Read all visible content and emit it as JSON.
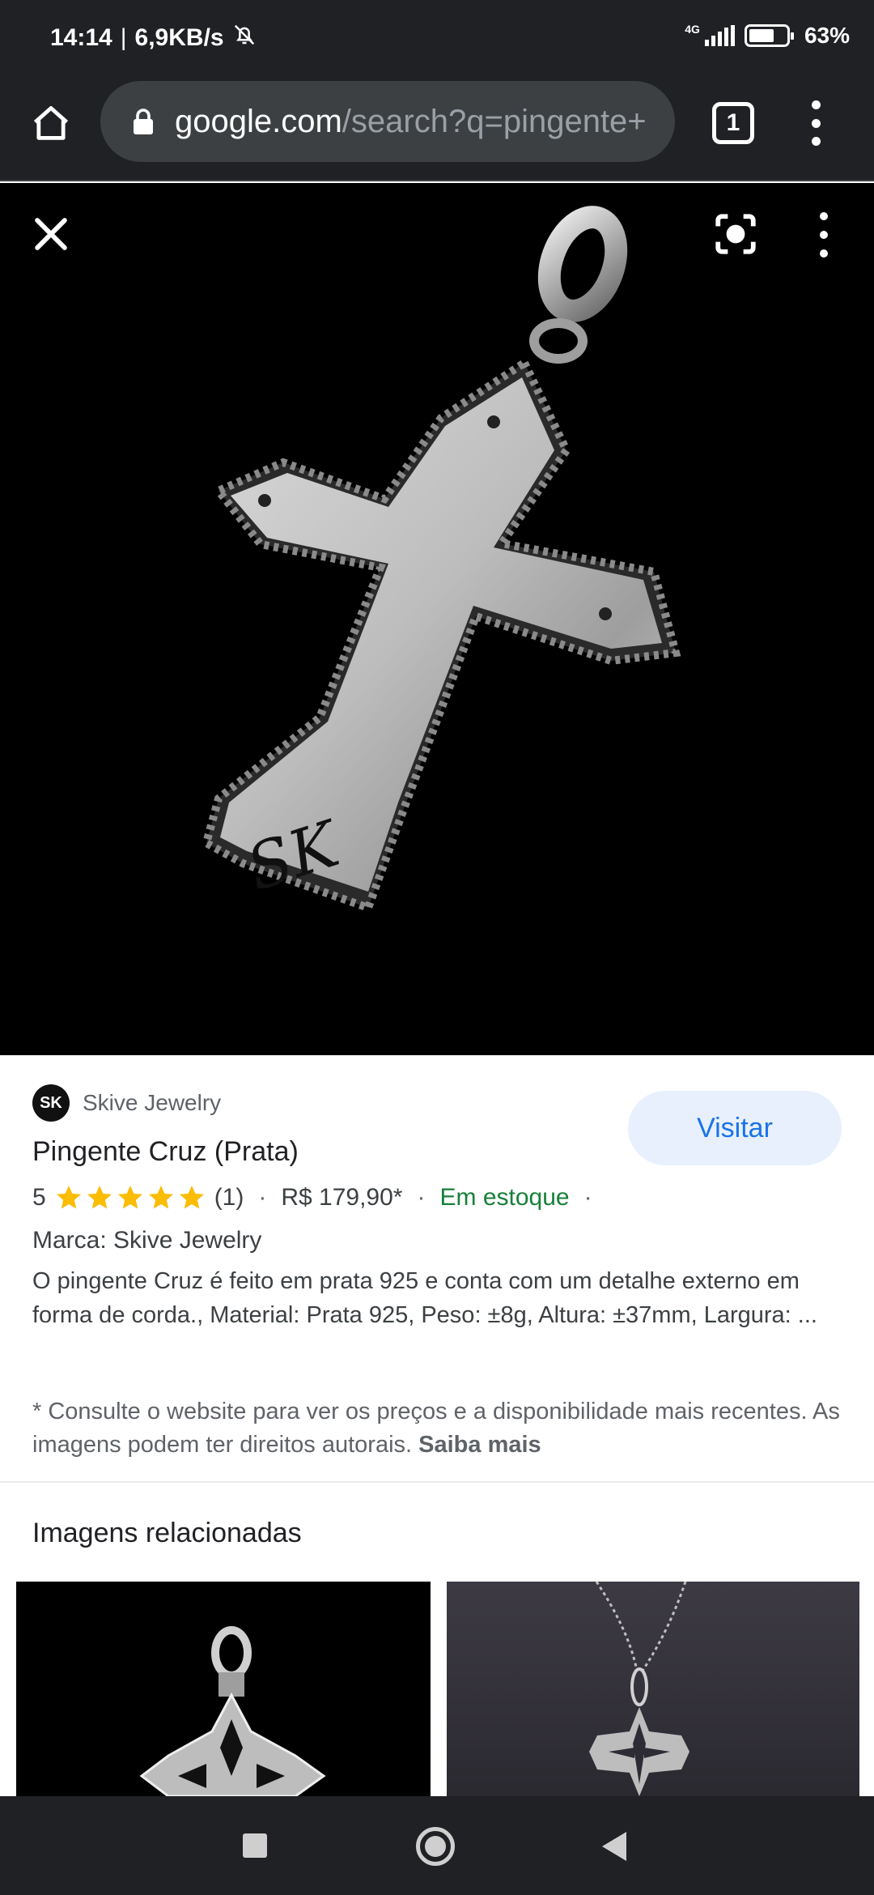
{
  "status_bar": {
    "time": "14:14",
    "separator": "|",
    "speed": "6,9KB/s",
    "network": "4G",
    "battery": "63%"
  },
  "browser": {
    "url_host": "google.com",
    "url_path": "/search?q=pingente+",
    "tab_count": "1"
  },
  "product": {
    "source": "Skive Jewelry",
    "source_logo_text": "SK",
    "visit_label": "Visitar",
    "title": "Pingente Cruz (Prata)",
    "rating": "5",
    "rating_value": 5,
    "reviews": "(1)",
    "price": "R$ 179,90*",
    "availability": "Em estoque",
    "brand": "Marca: Skive Jewelry",
    "description": "O pingente Cruz é feito em prata 925 e conta com um detalhe externo em forma de corda., Material: Prata 925, Peso: ±8g, Altura: ±37mm, Largura: ...",
    "disclaimer": "* Consulte o website para ver os preços e a disponibilidade mais recentes. As imagens podem ter direitos autorais.",
    "learn_more": "Saiba mais",
    "engraving": "SK"
  },
  "related": {
    "title": "Imagens relacionadas"
  },
  "colors": {
    "accent": "#1a73e8",
    "stock_green": "#188038",
    "star": "#fbbc04",
    "dark_bar": "#202124"
  }
}
